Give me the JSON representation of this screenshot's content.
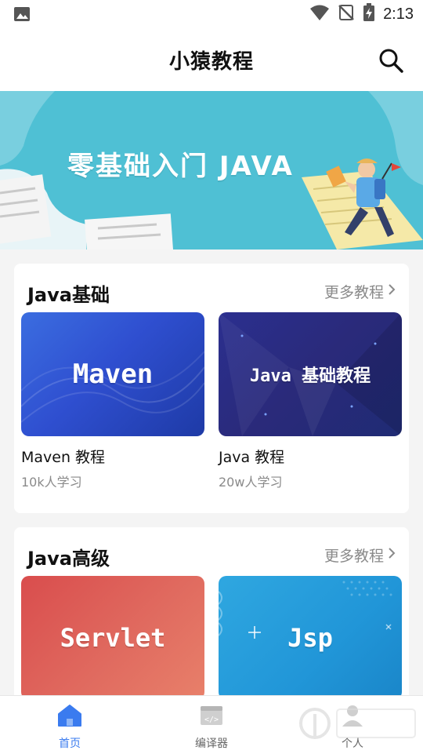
{
  "status_bar": {
    "time": "2:13",
    "icons": [
      "image-icon",
      "wifi-icon",
      "no-signal-icon",
      "battery-charging-icon"
    ]
  },
  "app_bar": {
    "title": "小猿教程",
    "search_icon": "search-icon"
  },
  "banner": {
    "text": "零基础入门 JAVA"
  },
  "sections": [
    {
      "title": "Java基础",
      "more_label": "更多教程",
      "courses": [
        {
          "thumb_text": "Maven",
          "name": "Maven 教程",
          "learners": "10k人学习"
        },
        {
          "thumb_text": "Java 基础教程",
          "name": "Java 教程",
          "learners": "20w人学习"
        }
      ]
    },
    {
      "title": "Java高级",
      "more_label": "更多教程",
      "courses": [
        {
          "thumb_text": "Servlet"
        },
        {
          "thumb_text": "Jsp"
        }
      ]
    }
  ],
  "bottom_nav": {
    "items": [
      {
        "label": "首页",
        "icon": "home-icon",
        "active": true
      },
      {
        "label": "编译器",
        "icon": "code-window-icon",
        "active": false
      },
      {
        "label": "个人",
        "icon": "person-icon",
        "active": false
      }
    ]
  },
  "colors": {
    "accent": "#3a7bef",
    "banner_bg": "#4fc0d4",
    "muted_text": "#8a8a8a"
  }
}
